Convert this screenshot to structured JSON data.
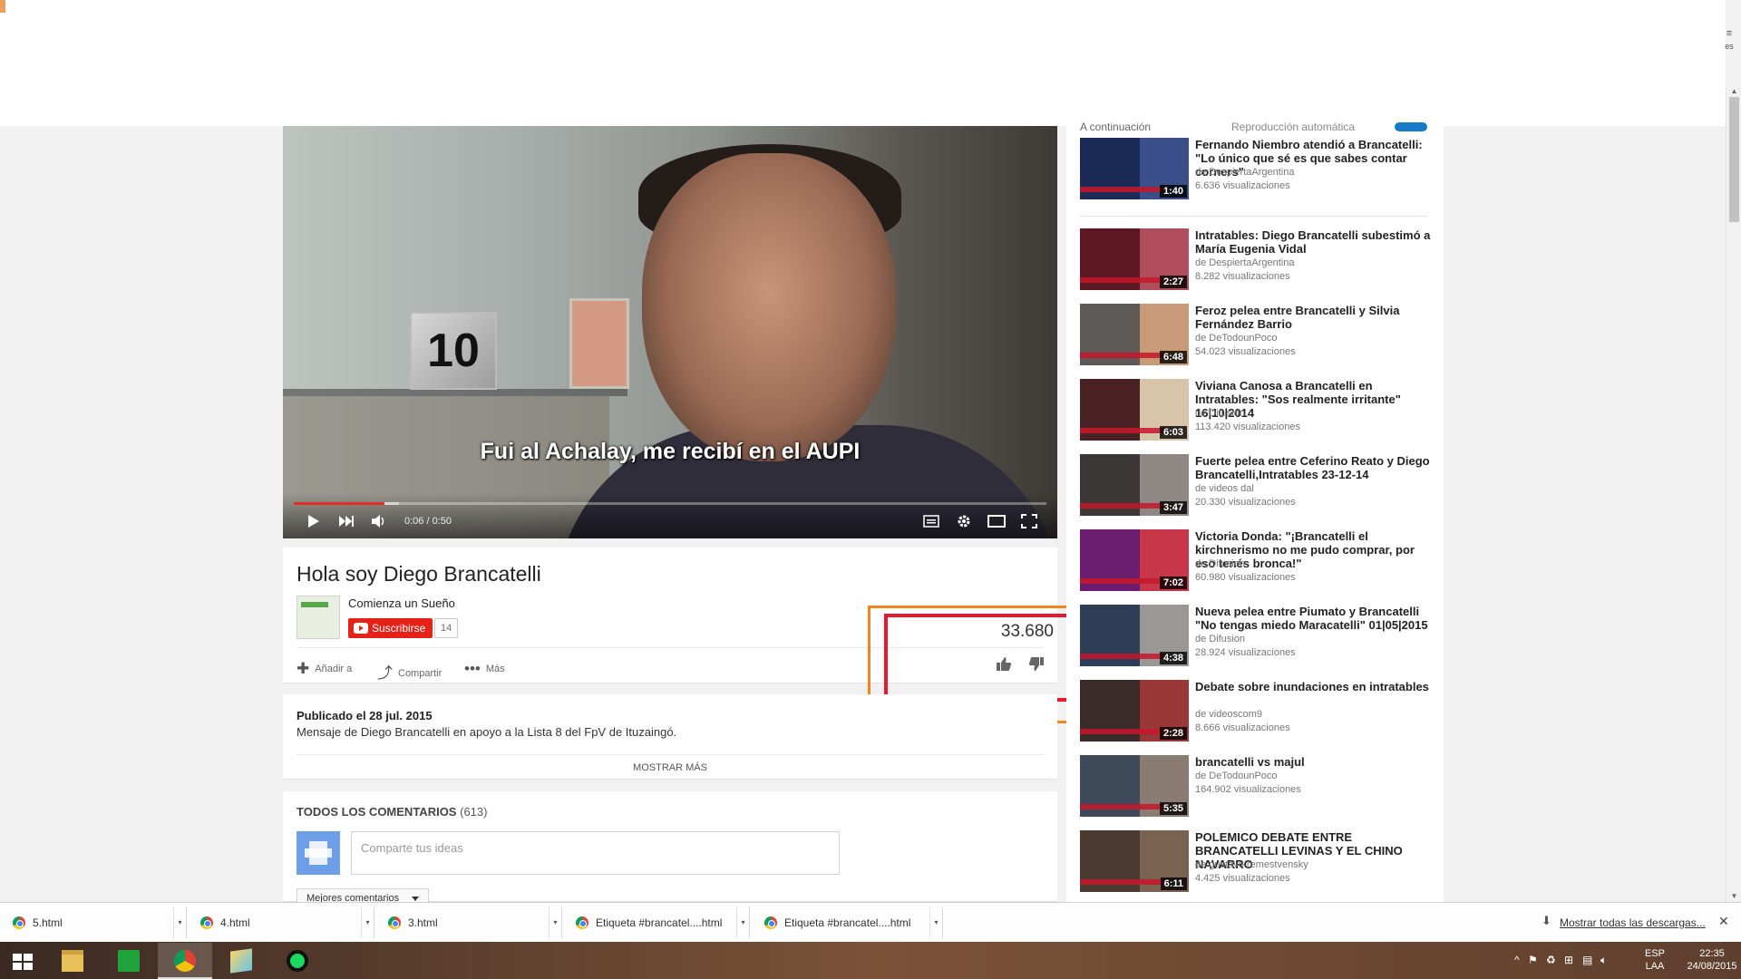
{
  "player": {
    "subtitle": "Fui al Achalay, me recibí en el AUPI",
    "current_time": "0:06",
    "duration": "0:50",
    "progress": 0.12,
    "buffered": 0.14,
    "prop_number": "10"
  },
  "video": {
    "title": "Hola soy Diego Brancatelli",
    "channel": "Comienza un Sueño",
    "subscribe_label": "Suscribirse",
    "subscriber_count": "14",
    "views": "33.680",
    "actions": {
      "add": "Añadir a",
      "share": "Compartir",
      "more": "Más"
    }
  },
  "description": {
    "published": "Publicado el 28 jul. 2015",
    "text": "Mensaje de Diego Brancatelli en apoyo a la Lista 8 del FpV de Ituzaingó.",
    "show_more": "MOSTRAR MÁS"
  },
  "comments": {
    "header": "TODOS LOS COMENTARIOS",
    "count": "(613)",
    "placeholder": "Comparte tus ideas",
    "sort_label": "Mejores comentarios"
  },
  "sidebar": {
    "up_next": "A continuación",
    "autoplay": "Reproducción automática",
    "items": [
      {
        "title": "Fernando Niembro atendió a Brancatelli: \"Lo único que sé es que sabes contar corners\"",
        "channel": "de DespiertaArgentina",
        "views": "6.636 visualizaciones",
        "duration": "1:40",
        "c1": "#1c2a56",
        "c2": "#3a4e8a"
      },
      {
        "title": "Intratables: Diego Brancatelli subestimó a María Eugenia Vidal",
        "channel": "de DespiertaArgentina",
        "views": "8.282 visualizaciones",
        "duration": "2:27",
        "c1": "#5b1822",
        "c2": "#b04d5c"
      },
      {
        "title": "Feroz pelea entre Brancatelli y Silvia Fernández Barrio",
        "channel": "de DeTodounPoco",
        "views": "54.023 visualizaciones",
        "duration": "6:48",
        "c1": "#5e5a58",
        "c2": "#c89a78"
      },
      {
        "title": "Viviana Canosa a Brancatelli en Intratables: \"Sos realmente irritante\" 16|10|2014",
        "channel": "de Difusion",
        "views": "113.420 visualizaciones",
        "duration": "6:03",
        "c1": "#4a2224",
        "c2": "#d8c4a8"
      },
      {
        "title": "Fuerte pelea entre Ceferino Reato y Diego Brancatelli,Intratables 23-12-14",
        "channel": "de videos dal",
        "views": "20.330 visualizaciones",
        "duration": "3:47",
        "c1": "#3c3838",
        "c2": "#8e8784"
      },
      {
        "title": "Victoria Donda: \"¡Brancatelli el kirchnerismo no me pudo comprar, por eso tenés bronca!\"",
        "channel": "de Difusion",
        "views": "60.980 visualizaciones",
        "duration": "7:02",
        "c1": "#6a1d6e",
        "c2": "#c8364a"
      },
      {
        "title": "Nueva pelea entre Piumato y Brancatelli \"No tengas miedo Maracatelli\" 01|05|2015",
        "channel": "de Difusion",
        "views": "28.924 visualizaciones",
        "duration": "4:38",
        "c1": "#2d3d56",
        "c2": "#9a9896"
      },
      {
        "title": "Debate sobre inundaciones en intratables",
        "channel": "de videoscom9",
        "views": "8.666 visualizaciones",
        "duration": "2:28",
        "c1": "#3b2a2a",
        "c2": "#9a3838"
      },
      {
        "title": "brancatelli vs majul",
        "channel": "de DeTodounPoco",
        "views": "164.902 visualizaciones",
        "duration": "5:35",
        "c1": "#3e4a5a",
        "c2": "#8a7c72"
      },
      {
        "title": "POLEMICO DEBATE ENTRE BRANCATELLI LEVINAS Y EL CHINO NAVARRO",
        "channel": "de gustavo remestvensky",
        "views": "4.425 visualizaciones",
        "duration": "6:11",
        "c1": "#4a3a30",
        "c2": "#7a6250"
      }
    ]
  },
  "downloads": {
    "items": [
      "5.html",
      "4.html",
      "3.html",
      "Etiqueta #brancatel....html",
      "Etiqueta #brancatel....html"
    ],
    "show_all": "Mostrar todas las descargas...",
    "close": "✕"
  },
  "taskbar": {
    "lang_line1": "ESP",
    "lang_line2": "LAA",
    "time": "22:35",
    "date": "24/08/2015"
  },
  "colors": {
    "youtube_red": "#e62117",
    "annotation_orange": "#f2861a",
    "annotation_red": "#e8182f",
    "progress_red": "#e52d27"
  },
  "icons": [
    "play-icon",
    "next-icon",
    "volume-icon",
    "captions-icon",
    "settings-icon",
    "theater-icon",
    "fullscreen-icon",
    "add-icon",
    "share-icon",
    "more-icon",
    "like-icon",
    "dislike-icon",
    "chrome-icon",
    "download-icon",
    "close-icon",
    "windows-icon",
    "explorer-icon",
    "store-icon",
    "spotify-icon"
  ]
}
